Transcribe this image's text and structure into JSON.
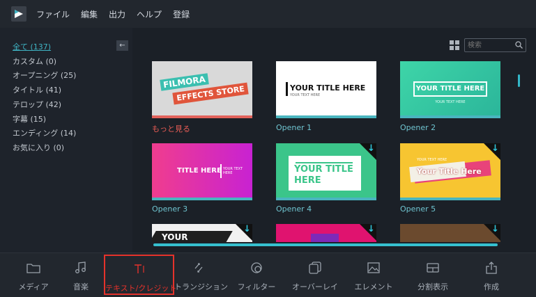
{
  "menu": [
    "ファイル",
    "編集",
    "出力",
    "ヘルプ",
    "登録"
  ],
  "sidebar": {
    "collapse_icon": "arrow-left-icon",
    "categories": [
      {
        "label": "全て (137)"
      },
      {
        "label": "カスタム (0)"
      },
      {
        "label": "オープニング (25)"
      },
      {
        "label": "タイトル (41)"
      },
      {
        "label": "テロップ (42)"
      },
      {
        "label": "字幕 (15)"
      },
      {
        "label": "エンディング (14)"
      },
      {
        "label": "お気に入り (0)"
      }
    ]
  },
  "search": {
    "placeholder": "検索"
  },
  "tiles": [
    {
      "caption": "もっと見る",
      "t1": "FILMORA",
      "t2": "EFFECTS STORE"
    },
    {
      "caption": "Opener 1",
      "t1": "YOUR TITLE HERE",
      "t2": "YOUR TEXT HERE"
    },
    {
      "caption": "Opener 2",
      "t1": "YOUR TITLE HERE",
      "t2": "YOUR TEXT HERE"
    },
    {
      "caption": "Opener 3",
      "t1": "TITLE HERE",
      "t2": "YOUR TEXT HERE"
    },
    {
      "caption": "Opener 4",
      "t1": "YOUR TITLE",
      "t2": "HERE"
    },
    {
      "caption": "Opener 5",
      "t1": "Your Title Here",
      "t2": "YOUR TEXT HERE"
    },
    {
      "t1": "YOUR"
    }
  ],
  "toolbar": [
    {
      "label": "メディア",
      "icon": "folder-icon"
    },
    {
      "label": "音楽",
      "icon": "music-note-icon"
    },
    {
      "label": "テキスト/クレジット",
      "icon": "text-icon"
    },
    {
      "label": "トランジション",
      "icon": "transition-icon"
    },
    {
      "label": "フィルター",
      "icon": "filter-icon"
    },
    {
      "label": "オーバーレイ",
      "icon": "overlay-icon"
    },
    {
      "label": "エレメント",
      "icon": "image-icon"
    },
    {
      "label": "分割表示",
      "icon": "split-screen-icon"
    },
    {
      "label": "作成",
      "icon": "export-icon"
    }
  ],
  "colors": {
    "accent": "#3fb4c4",
    "active_tool": "#e5322b",
    "background": "#1c2129"
  }
}
